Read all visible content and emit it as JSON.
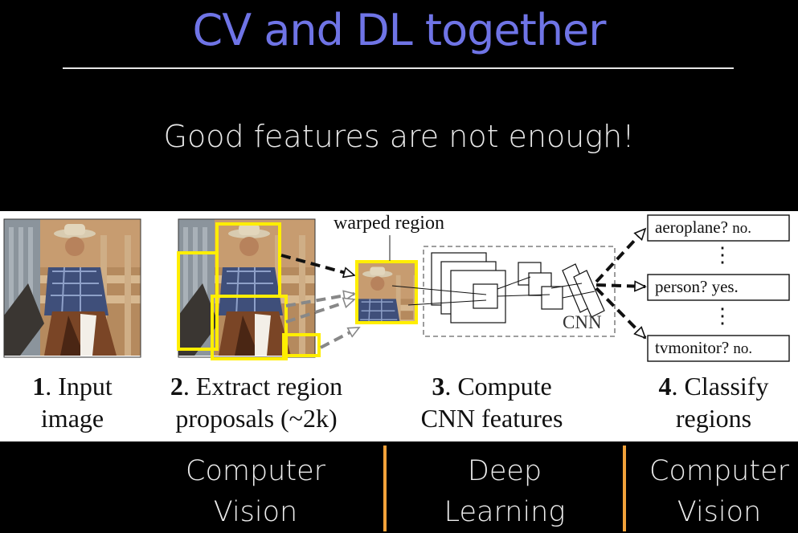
{
  "title": "CV and DL together",
  "subtitle": "Good features are not enough!",
  "diagram": {
    "warped_label": "warped region",
    "cnn_label": "CNN",
    "steps": [
      {
        "num": "1",
        "text": ". Input",
        "line2": "image"
      },
      {
        "num": "2",
        "text": ". Extract region",
        "line2": "proposals (~2k)"
      },
      {
        "num": "3",
        "text": ". Compute",
        "line2": "CNN features"
      },
      {
        "num": "4",
        "text": ". Classify",
        "line2": "regions"
      }
    ],
    "classes": [
      {
        "label": "aeroplane?",
        "answer": "no."
      },
      {
        "label": "person?",
        "answer": "yes."
      },
      {
        "label": "tvmonitor?",
        "answer": "no."
      }
    ],
    "ellipsis": "⋮"
  },
  "bottom": {
    "left": {
      "line1": "Computer",
      "line2": "Vision"
    },
    "middle": {
      "line1": "Deep",
      "line2": "Learning"
    },
    "right": {
      "line1": "Computer",
      "line2": "Vision"
    }
  },
  "colors": {
    "title": "#6f74e6",
    "divider": "#f2a23a",
    "proposal": "#ffee00"
  }
}
